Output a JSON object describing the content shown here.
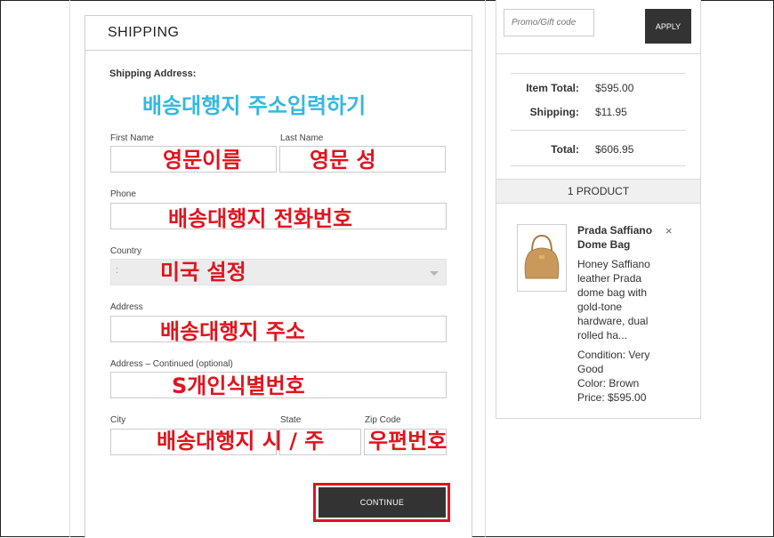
{
  "shipping": {
    "title": "SHIPPING",
    "section_label": "Shipping Address:",
    "annotation_title": "배송대행지 주소입력하기",
    "fields": {
      "first_name": {
        "label": "First Name",
        "annotation": "영문이름"
      },
      "last_name": {
        "label": "Last Name",
        "annotation": "영문 성"
      },
      "phone": {
        "label": "Phone",
        "annotation": "배송대행지 전화번호"
      },
      "country": {
        "label": "Country",
        "value": ":",
        "annotation": "미국 설정"
      },
      "address": {
        "label": "Address",
        "annotation": "배송대행지 주소"
      },
      "address2": {
        "label": "Address – Continued (optional)",
        "annotation": "S개인식별번호"
      },
      "city": {
        "label": "City",
        "annotation": "배송대행지 시 / 주"
      },
      "state": {
        "label": "State"
      },
      "zip": {
        "label": "Zip Code",
        "annotation": "우편번호"
      }
    },
    "continue_label": "CONTINUE"
  },
  "summary": {
    "promo_placeholder": "Promo/Gift code",
    "apply_label": "APPLY",
    "item_total_label": "Item Total:",
    "item_total_value": "$595.00",
    "shipping_label": "Shipping:",
    "shipping_value": "$11.95",
    "total_label": "Total:",
    "total_value": "$606.95",
    "product_count": "1 PRODUCT"
  },
  "product": {
    "name": "Prada Saffiano Dome Bag",
    "description": "Honey Saffiano leather Prada dome bag with gold-tone hardware, dual rolled ha...",
    "condition": "Condition: Very Good",
    "color": "Color: Brown",
    "price": "Price: $595.00",
    "remove_symbol": "×",
    "image_icon": "handbag-icon"
  },
  "colors": {
    "annotation_red": "#e0141e",
    "annotation_blue": "#35b8e0",
    "button_dark": "#333333",
    "bag_tan": "#c9995b"
  }
}
